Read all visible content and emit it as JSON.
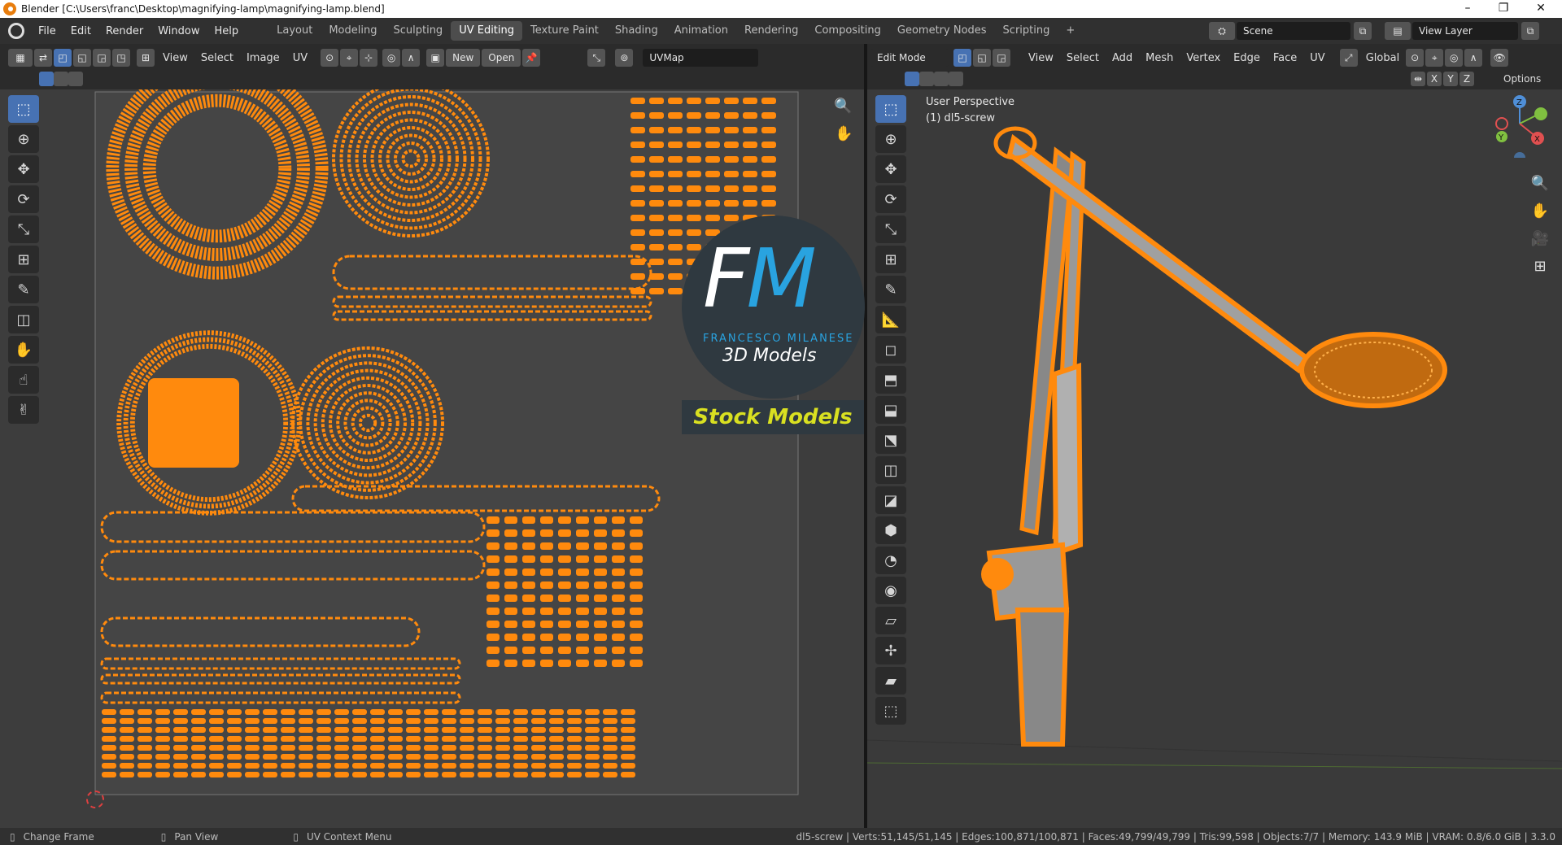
{
  "window": {
    "title": "Blender [C:\\Users\\franc\\Desktop\\magnifying-lamp\\magnifying-lamp.blend]",
    "minimize": "–",
    "maximize": "❐",
    "close": "✕"
  },
  "menus": [
    "File",
    "Edit",
    "Render",
    "Window",
    "Help"
  ],
  "workspaces": [
    "Layout",
    "Modeling",
    "Sculpting",
    "UV Editing",
    "Texture Paint",
    "Shading",
    "Animation",
    "Rendering",
    "Compositing",
    "Geometry Nodes",
    "Scripting"
  ],
  "active_workspace": "UV Editing",
  "add_workspace": "+",
  "scene": {
    "label": "Scene"
  },
  "view_layer": {
    "label": "View Layer"
  },
  "uv_editor": {
    "menus": [
      "View",
      "Select",
      "Image",
      "UV"
    ],
    "new_label": "New",
    "open_label": "Open",
    "uvmap_name": "UVMap"
  },
  "viewport": {
    "mode": "Edit Mode",
    "menus": [
      "View",
      "Select",
      "Add",
      "Mesh",
      "Vertex",
      "Edge",
      "Face",
      "UV"
    ],
    "orientation": "Global",
    "axis_x": "X",
    "axis_y": "Y",
    "axis_z": "Z",
    "options": "Options",
    "perspective": "User Perspective",
    "object": "(1) dl5-screw"
  },
  "gizmo": {
    "z": "Z",
    "y": "Y",
    "x": "X"
  },
  "watermark": {
    "letters": "FM",
    "name": "FRANCESCO MILANESE",
    "sub": "3D Models",
    "banner": "Stock Models"
  },
  "colors": {
    "accent": "#4772b3",
    "mesh": "#ff8a0d",
    "wm_blue": "#29a3e0",
    "wm_yellow": "#d9e021"
  },
  "status": {
    "left1": "Change Frame",
    "left2": "Pan View",
    "left3": "UV Context Menu",
    "stats": "dl5-screw | Verts:51,145/51,145 | Edges:100,871/100,871 | Faces:49,799/49,799 | Tris:99,598 | Objects:7/7 | Memory: 143.9 MiB | VRAM: 0.8/6.0 GiB | 3.3.0"
  }
}
